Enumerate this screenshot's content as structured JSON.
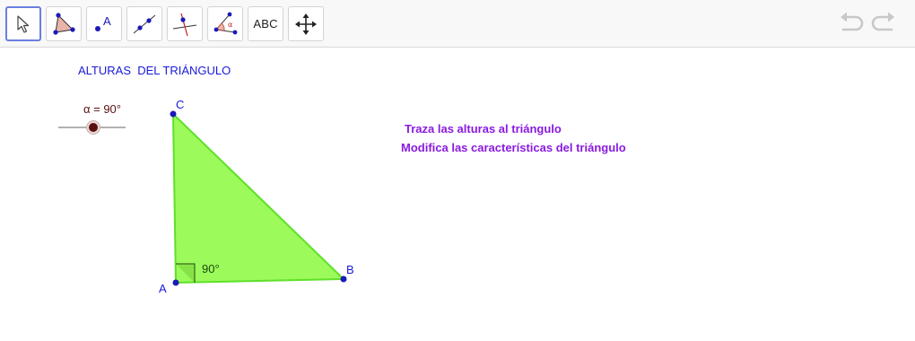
{
  "toolbar": {
    "tools": [
      {
        "name": "move-tool",
        "icon": "arrow-cursor-icon"
      },
      {
        "name": "polygon-tool",
        "icon": "polygon-icon"
      },
      {
        "name": "point-tool",
        "icon": "point-icon",
        "glyph": "A"
      },
      {
        "name": "line-tool",
        "icon": "line-icon"
      },
      {
        "name": "perpendicular-line-tool",
        "icon": "perpendicular-icon"
      },
      {
        "name": "angle-tool",
        "icon": "angle-icon",
        "glyph": "α"
      },
      {
        "name": "text-tool",
        "icon": "text-icon",
        "label": "ABC"
      },
      {
        "name": "move-graphics-view-tool",
        "icon": "move-arrows-icon"
      }
    ],
    "undo_icon": "undo-icon",
    "redo_icon": "redo-icon"
  },
  "canvas": {
    "title": "ALTURAS  DEL TRIÁNGULO",
    "slider": {
      "label": "α = 90°",
      "value": 90
    },
    "instructions": [
      "Traza las alturas al triángulo",
      "Modifica las características del triángulo"
    ],
    "points": {
      "a": "A",
      "b": "B",
      "c": "C"
    },
    "angle_label": "90°"
  },
  "colors": {
    "triangle_fill": "#99ff55",
    "triangle_stroke": "#5fd82a",
    "point": "#1a1ab8",
    "title": "#1a1ad6",
    "instructions": "#8a1ae0",
    "slider_label": "#5a1010"
  }
}
